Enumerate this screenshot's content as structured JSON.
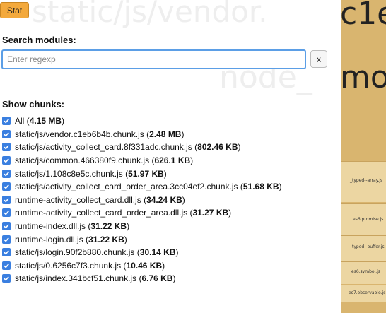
{
  "toolbar": {
    "stat_label": "Stat"
  },
  "search": {
    "label": "Search modules:",
    "placeholder": "Enter regexp",
    "value": "",
    "clear_label": "x"
  },
  "chunks": {
    "label": "Show chunks:",
    "items": [
      {
        "name": "All",
        "size": "4.15 MB",
        "checked": true
      },
      {
        "name": "static/js/vendor.c1eb6b4b.chunk.js",
        "size": "2.48 MB",
        "checked": true
      },
      {
        "name": "static/js/activity_collect_card.8f331adc.chunk.js",
        "size": "802.46 KB",
        "checked": true
      },
      {
        "name": "static/js/common.466380f9.chunk.js",
        "size": "626.1 KB",
        "checked": true
      },
      {
        "name": "static/js/1.108c8e5c.chunk.js",
        "size": "51.97 KB",
        "checked": true
      },
      {
        "name": "static/js/activity_collect_card_order_area.3cc04ef2.chunk.js",
        "size": "51.68 KB",
        "checked": true
      },
      {
        "name": "runtime-activity_collect_card.dll.js",
        "size": "34.24 KB",
        "checked": true
      },
      {
        "name": "runtime-activity_collect_card_order_area.dll.js",
        "size": "31.27 KB",
        "checked": true
      },
      {
        "name": "runtime-index.dll.js",
        "size": "31.22 KB",
        "checked": true
      },
      {
        "name": "runtime-login.dll.js",
        "size": "31.22 KB",
        "checked": true
      },
      {
        "name": "static/js/login.90f2b880.chunk.js",
        "size": "30.14 KB",
        "checked": true
      },
      {
        "name": "static/js/0.6256c7f3.chunk.js",
        "size": "10.46 KB",
        "checked": true
      },
      {
        "name": "static/js/index.341bcf51.chunk.js",
        "size": "6.76 KB",
        "checked": true
      }
    ]
  },
  "treemap": {
    "labels": [
      "c1e",
      "mo",
      "_typed--array.js",
      "es6.promise.js",
      "_typed--buffer.js",
      "es6.symbol.js",
      "es7.observable.js"
    ],
    "ghost_labels": [
      "static/js/vendor.",
      "node_"
    ]
  },
  "colors": {
    "accent": "#3a7fe0",
    "stat_button": "#f3a93c",
    "treemap_bg": "#d9b56f"
  }
}
